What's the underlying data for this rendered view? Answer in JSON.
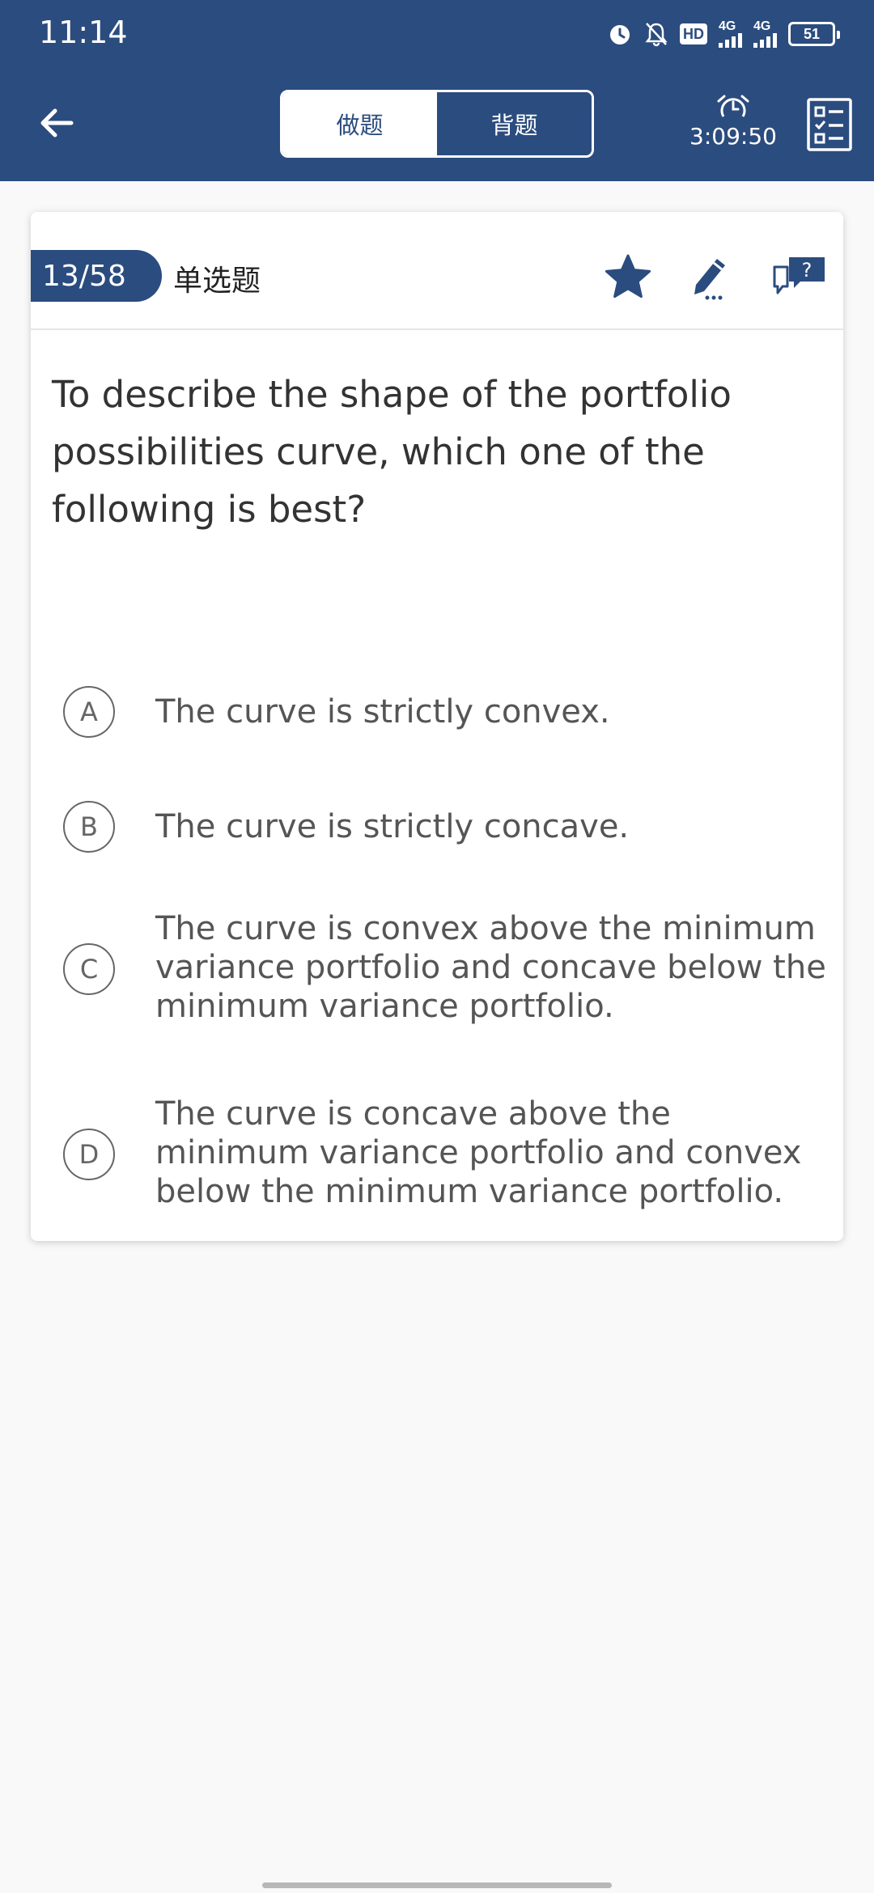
{
  "status_bar": {
    "time": "11:14",
    "hd_label": "HD",
    "network_1": "4G",
    "network_2": "4G",
    "battery": "51"
  },
  "header": {
    "tabs": [
      {
        "label": "做题",
        "active": true
      },
      {
        "label": "背题",
        "active": false
      }
    ],
    "timer": "3:09:50",
    "accent_color": "#2b4c7e"
  },
  "card": {
    "counter": "13/58",
    "question_type": "单选题",
    "question": "To describe the shape of the portfolio possibilities curve, which one of the following is best?",
    "options": [
      {
        "letter": "A",
        "text": "The curve is strictly convex."
      },
      {
        "letter": "B",
        "text": "The curve is strictly concave."
      },
      {
        "letter": "C",
        "text": "The curve is convex above the minimum variance portfolio and concave below the minimum variance portfolio."
      },
      {
        "letter": "D",
        "text": "The curve is concave above the minimum variance portfolio and convex below the minimum variance portfolio."
      }
    ],
    "icons": [
      "star-icon",
      "edit-note-icon",
      "feedback-question-icon"
    ]
  }
}
